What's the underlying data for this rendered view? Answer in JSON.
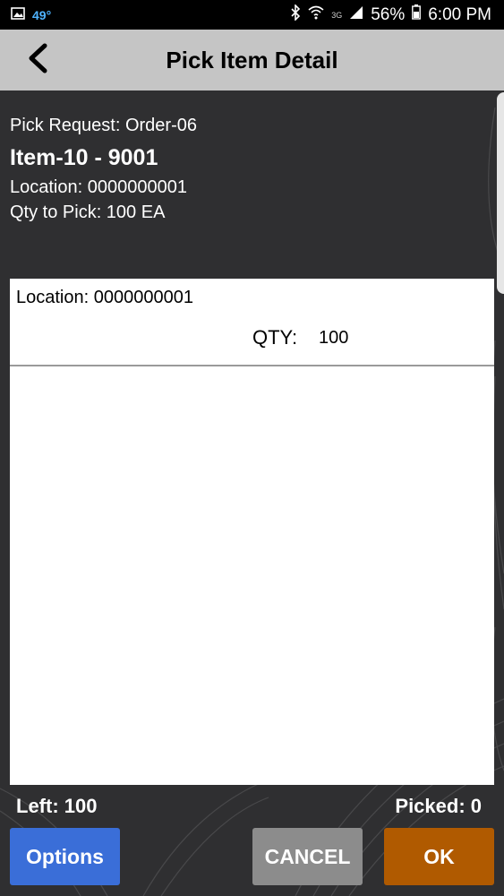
{
  "statusbar": {
    "temperature": "49°",
    "network": "3G",
    "battery": "56%",
    "time": "6:00 PM"
  },
  "header": {
    "title": "Pick Item Detail"
  },
  "info": {
    "pick_request": "Pick Request: Order-06",
    "item": "Item-10 - 9001",
    "location": "Location: 0000000001",
    "qty_to_pick": "Qty to Pick: 100 EA"
  },
  "list": {
    "rows": [
      {
        "location": "Location: 0000000001",
        "qty_label": "QTY:",
        "qty_value": "100"
      }
    ]
  },
  "footer": {
    "left": "Left: 100",
    "picked": "Picked: 0"
  },
  "buttons": {
    "options": "Options",
    "cancel": "CANCEL",
    "ok": "OK"
  },
  "colors": {
    "background": "#2f2f31",
    "header": "#c5c5c5",
    "options": "#3a6ed8",
    "cancel": "#8c8c8c",
    "ok": "#b05a00",
    "temperature": "#4fb3ff"
  }
}
